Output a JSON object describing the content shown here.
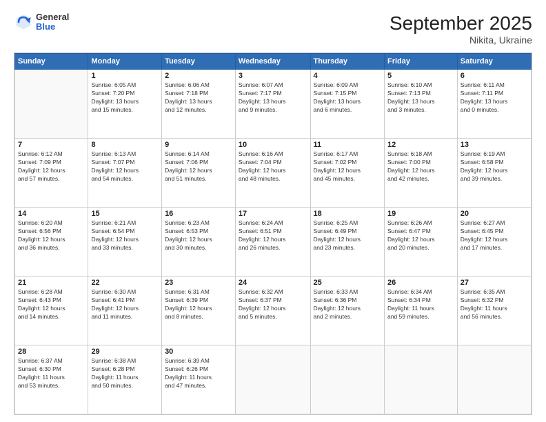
{
  "header": {
    "logo_general": "General",
    "logo_blue": "Blue",
    "title": "September 2025",
    "subtitle": "Nikita, Ukraine"
  },
  "columns": [
    "Sunday",
    "Monday",
    "Tuesday",
    "Wednesday",
    "Thursday",
    "Friday",
    "Saturday"
  ],
  "weeks": [
    [
      {
        "day": "",
        "info": ""
      },
      {
        "day": "1",
        "info": "Sunrise: 6:05 AM\nSunset: 7:20 PM\nDaylight: 13 hours\nand 15 minutes."
      },
      {
        "day": "2",
        "info": "Sunrise: 6:06 AM\nSunset: 7:18 PM\nDaylight: 13 hours\nand 12 minutes."
      },
      {
        "day": "3",
        "info": "Sunrise: 6:07 AM\nSunset: 7:17 PM\nDaylight: 13 hours\nand 9 minutes."
      },
      {
        "day": "4",
        "info": "Sunrise: 6:09 AM\nSunset: 7:15 PM\nDaylight: 13 hours\nand 6 minutes."
      },
      {
        "day": "5",
        "info": "Sunrise: 6:10 AM\nSunset: 7:13 PM\nDaylight: 13 hours\nand 3 minutes."
      },
      {
        "day": "6",
        "info": "Sunrise: 6:11 AM\nSunset: 7:11 PM\nDaylight: 13 hours\nand 0 minutes."
      }
    ],
    [
      {
        "day": "7",
        "info": "Sunrise: 6:12 AM\nSunset: 7:09 PM\nDaylight: 12 hours\nand 57 minutes."
      },
      {
        "day": "8",
        "info": "Sunrise: 6:13 AM\nSunset: 7:07 PM\nDaylight: 12 hours\nand 54 minutes."
      },
      {
        "day": "9",
        "info": "Sunrise: 6:14 AM\nSunset: 7:06 PM\nDaylight: 12 hours\nand 51 minutes."
      },
      {
        "day": "10",
        "info": "Sunrise: 6:16 AM\nSunset: 7:04 PM\nDaylight: 12 hours\nand 48 minutes."
      },
      {
        "day": "11",
        "info": "Sunrise: 6:17 AM\nSunset: 7:02 PM\nDaylight: 12 hours\nand 45 minutes."
      },
      {
        "day": "12",
        "info": "Sunrise: 6:18 AM\nSunset: 7:00 PM\nDaylight: 12 hours\nand 42 minutes."
      },
      {
        "day": "13",
        "info": "Sunrise: 6:19 AM\nSunset: 6:58 PM\nDaylight: 12 hours\nand 39 minutes."
      }
    ],
    [
      {
        "day": "14",
        "info": "Sunrise: 6:20 AM\nSunset: 6:56 PM\nDaylight: 12 hours\nand 36 minutes."
      },
      {
        "day": "15",
        "info": "Sunrise: 6:21 AM\nSunset: 6:54 PM\nDaylight: 12 hours\nand 33 minutes."
      },
      {
        "day": "16",
        "info": "Sunrise: 6:23 AM\nSunset: 6:53 PM\nDaylight: 12 hours\nand 30 minutes."
      },
      {
        "day": "17",
        "info": "Sunrise: 6:24 AM\nSunset: 6:51 PM\nDaylight: 12 hours\nand 26 minutes."
      },
      {
        "day": "18",
        "info": "Sunrise: 6:25 AM\nSunset: 6:49 PM\nDaylight: 12 hours\nand 23 minutes."
      },
      {
        "day": "19",
        "info": "Sunrise: 6:26 AM\nSunset: 6:47 PM\nDaylight: 12 hours\nand 20 minutes."
      },
      {
        "day": "20",
        "info": "Sunrise: 6:27 AM\nSunset: 6:45 PM\nDaylight: 12 hours\nand 17 minutes."
      }
    ],
    [
      {
        "day": "21",
        "info": "Sunrise: 6:28 AM\nSunset: 6:43 PM\nDaylight: 12 hours\nand 14 minutes."
      },
      {
        "day": "22",
        "info": "Sunrise: 6:30 AM\nSunset: 6:41 PM\nDaylight: 12 hours\nand 11 minutes."
      },
      {
        "day": "23",
        "info": "Sunrise: 6:31 AM\nSunset: 6:39 PM\nDaylight: 12 hours\nand 8 minutes."
      },
      {
        "day": "24",
        "info": "Sunrise: 6:32 AM\nSunset: 6:37 PM\nDaylight: 12 hours\nand 5 minutes."
      },
      {
        "day": "25",
        "info": "Sunrise: 6:33 AM\nSunset: 6:36 PM\nDaylight: 12 hours\nand 2 minutes."
      },
      {
        "day": "26",
        "info": "Sunrise: 6:34 AM\nSunset: 6:34 PM\nDaylight: 11 hours\nand 59 minutes."
      },
      {
        "day": "27",
        "info": "Sunrise: 6:35 AM\nSunset: 6:32 PM\nDaylight: 11 hours\nand 56 minutes."
      }
    ],
    [
      {
        "day": "28",
        "info": "Sunrise: 6:37 AM\nSunset: 6:30 PM\nDaylight: 11 hours\nand 53 minutes."
      },
      {
        "day": "29",
        "info": "Sunrise: 6:38 AM\nSunset: 6:28 PM\nDaylight: 11 hours\nand 50 minutes."
      },
      {
        "day": "30",
        "info": "Sunrise: 6:39 AM\nSunset: 6:26 PM\nDaylight: 11 hours\nand 47 minutes."
      },
      {
        "day": "",
        "info": ""
      },
      {
        "day": "",
        "info": ""
      },
      {
        "day": "",
        "info": ""
      },
      {
        "day": "",
        "info": ""
      }
    ]
  ]
}
